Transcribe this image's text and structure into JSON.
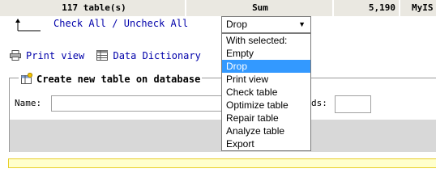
{
  "summary": {
    "count": "117 table(s)",
    "op": "Sum",
    "size": "5,190",
    "engine": "MyIS"
  },
  "bulk": {
    "check_all": "Check All",
    "separator": "/",
    "uncheck_all": "Uncheck All",
    "select_value": "Drop",
    "options": [
      "With selected:",
      "Empty",
      "Drop",
      "Print view",
      "Check table",
      "Optimize table",
      "Repair table",
      "Analyze table",
      "Export"
    ],
    "selected_index": 2
  },
  "links": {
    "print_view": "Print view",
    "data_dictionary": "Data Dictionary"
  },
  "create_table": {
    "legend": "Create new table on database",
    "name_label": "Name:",
    "name_value": "",
    "fields_label": "ds:",
    "fields_value": ""
  },
  "icons": {
    "arrow": "arrow-up-left-icon",
    "print": "printer-icon",
    "dictionary": "table-icon",
    "new_table": "new-table-icon"
  }
}
